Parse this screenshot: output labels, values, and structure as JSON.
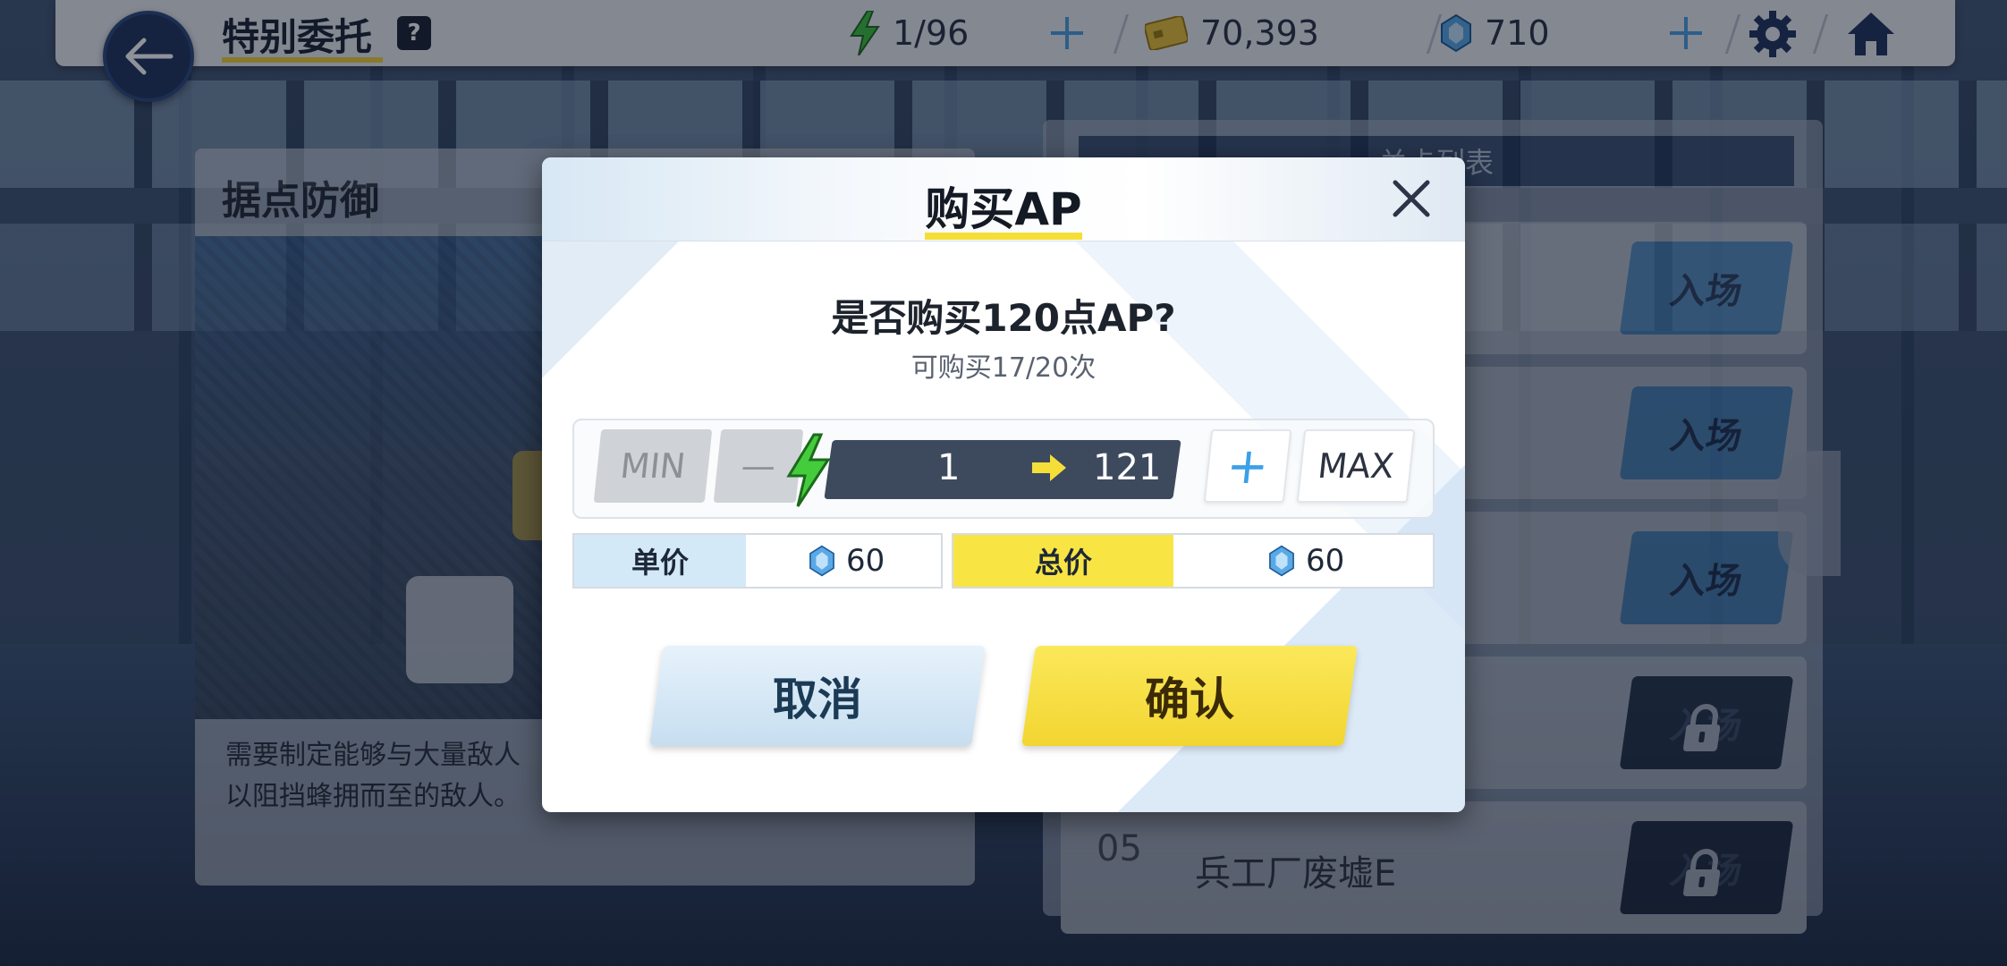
{
  "header": {
    "title": "特别委托",
    "help_label": "?",
    "ap": "1/96",
    "credits": "70,393",
    "gems": "710"
  },
  "left_card": {
    "title": "据点防御",
    "description_line1": "需要制定能够与大量敌人",
    "description_line2": "以阻挡蜂拥而至的敌人。"
  },
  "right_panel": {
    "header": "关卡列表",
    "stages": [
      {
        "enter_label": "入场",
        "locked": false
      },
      {
        "enter_label": "入场",
        "locked": false
      },
      {
        "enter_label": "入场",
        "locked": false
      },
      {
        "enter_label": "入场",
        "locked": true
      },
      {
        "number": "05",
        "name": "兵工厂废墟E",
        "enter_label": "入场",
        "locked": true
      }
    ]
  },
  "modal": {
    "title": "购买AP",
    "question": "是否购买120点AP?",
    "remaining": "可购买17/20次",
    "min_label": "MIN",
    "minus_label": "—",
    "plus_label": "+",
    "max_label": "MAX",
    "quantity": "1",
    "result_ap": "121",
    "unit_price_label": "单价",
    "unit_price": "60",
    "total_price_label": "总价",
    "total_price": "60",
    "cancel_label": "取消",
    "confirm_label": "确认"
  },
  "colors": {
    "accent_yellow": "#f5de38",
    "navy": "#1f3560",
    "gem_blue": "#5aa8e6",
    "ap_green": "#3ec13e"
  }
}
